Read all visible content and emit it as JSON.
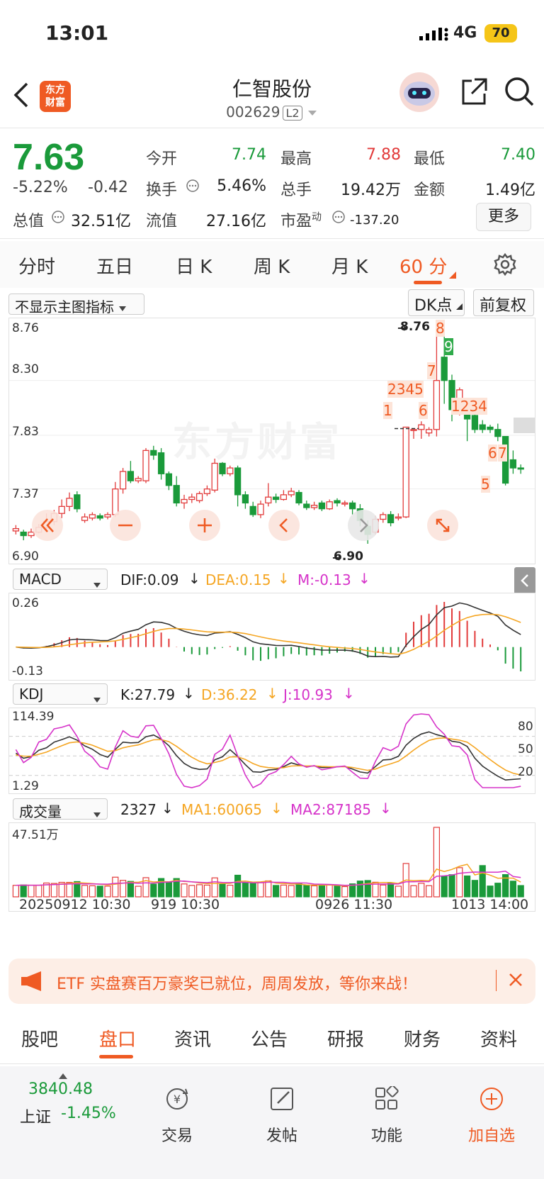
{
  "status": {
    "time": "13:01",
    "network": "4G",
    "battery": "70"
  },
  "header": {
    "title": "仁智股份",
    "code": "002629",
    "level": "L2",
    "logo_text": [
      "东方",
      "财富"
    ]
  },
  "quote": {
    "price": "7.63",
    "change_pct": "-5.22%",
    "change_abs": "-0.42",
    "total_value_label": "总值",
    "total_value": "32.51亿",
    "fields": [
      {
        "label": "今开",
        "value": "7.74"
      },
      {
        "label": "最高",
        "value": "7.88"
      },
      {
        "label": "最低",
        "value": "7.40"
      },
      {
        "label": "换手",
        "value": "5.46%"
      },
      {
        "label": "总手",
        "value": "19.42万"
      },
      {
        "label": "金额",
        "value": "1.49亿"
      },
      {
        "label": "流值",
        "value": "27.16亿"
      },
      {
        "label": "市盈",
        "sup": "动",
        "value": "-137.20"
      }
    ],
    "more": "更多"
  },
  "tabs": [
    "分时",
    "五日",
    "日 K",
    "周 K",
    "月 K",
    "60 分"
  ],
  "active_tab": "60 分",
  "main_chart": {
    "indicator_select": "不显示主图指标",
    "dk_button": "DK点",
    "adjust_button": "前复权",
    "y_labels": [
      "8.76",
      "8.30",
      "7.83",
      "7.37",
      "6.90"
    ],
    "max_label": "8.76",
    "min_label": "6.90",
    "watermark": "东方财富",
    "markers": [
      "1",
      "2345",
      "6",
      "7",
      "8",
      "9",
      "1234",
      "5",
      "6",
      "7"
    ]
  },
  "macd": {
    "select": "MACD",
    "dif": "DIF:0.09",
    "dea": "DEA:0.15",
    "m": "M:-0.13",
    "top": "0.26",
    "bottom": "-0.13"
  },
  "kdj": {
    "select": "KDJ",
    "k": "K:27.79",
    "d": "D:36.22",
    "j": "J:10.93",
    "top": "114.39",
    "bottom": "1.29",
    "levels": [
      "80",
      "50",
      "20"
    ]
  },
  "volume": {
    "select": "成交量",
    "value": "2327",
    "ma1": "MA1:60065",
    "ma2": "MA2:87185",
    "top": "47.51万"
  },
  "x_labels": [
    "20250912 10:30",
    "919 10:30",
    "0926 11:30",
    "1013 14:00"
  ],
  "banner": {
    "text": "ETF 实盘赛百万豪奖已就位，周周发放，等你来战！"
  },
  "bottom_tabs": [
    "股吧",
    "盘口",
    "资讯",
    "公告",
    "研报",
    "财务",
    "资料"
  ],
  "active_bottom_tab": "盘口",
  "bottom_bar": {
    "index_value": "3840.48",
    "index_name": "上证",
    "index_change": "-1.45%",
    "buttons": [
      "交易",
      "发帖",
      "功能",
      "加自选"
    ]
  },
  "colors": {
    "up": "#e23b3b",
    "down": "#1a9a3a",
    "accent": "#ef5a23",
    "dea": "#f5a623",
    "j": "#d633c9"
  },
  "candles": [
    [
      7.01,
      7.03,
      6.98,
      7.06
    ],
    [
      7.0,
      6.97,
      6.93,
      7.02
    ],
    [
      6.97,
      7.0,
      6.95,
      7.03
    ],
    [
      7.0,
      7.04,
      6.99,
      7.07
    ],
    [
      7.04,
      7.09,
      7.02,
      7.16
    ],
    [
      7.09,
      7.16,
      7.06,
      7.19
    ],
    [
      7.16,
      7.22,
      7.12,
      7.28
    ],
    [
      7.22,
      7.29,
      7.18,
      7.34
    ],
    [
      7.32,
      7.2,
      7.17,
      7.35
    ],
    [
      7.1,
      7.13,
      7.08,
      7.16
    ],
    [
      7.12,
      7.15,
      7.1,
      7.17
    ],
    [
      7.14,
      7.12,
      7.1,
      7.16
    ],
    [
      7.13,
      7.15,
      7.11,
      7.17
    ],
    [
      7.15,
      7.37,
      7.13,
      7.43
    ],
    [
      7.37,
      7.52,
      7.33,
      7.55
    ],
    [
      7.52,
      7.44,
      7.42,
      7.61
    ],
    [
      7.44,
      7.46,
      7.42,
      7.48
    ],
    [
      7.44,
      7.7,
      7.42,
      7.72
    ],
    [
      7.7,
      7.66,
      7.62,
      7.74
    ],
    [
      7.68,
      7.5,
      7.45,
      7.72
    ],
    [
      7.5,
      7.4,
      7.36,
      7.52
    ],
    [
      7.4,
      7.25,
      7.22,
      7.48
    ],
    [
      7.25,
      7.28,
      7.2,
      7.32
    ],
    [
      7.28,
      7.3,
      7.25,
      7.33
    ],
    [
      7.27,
      7.33,
      7.25,
      7.35
    ],
    [
      7.33,
      7.37,
      7.31,
      7.4
    ],
    [
      7.36,
      7.59,
      7.34,
      7.63
    ],
    [
      7.59,
      7.5,
      7.48,
      7.6
    ],
    [
      7.5,
      7.55,
      7.48,
      7.57
    ],
    [
      7.55,
      7.32,
      7.22,
      7.57
    ],
    [
      7.32,
      7.25,
      7.2,
      7.35
    ],
    [
      7.22,
      7.15,
      7.13,
      7.26
    ],
    [
      7.15,
      7.24,
      7.12,
      7.27
    ],
    [
      7.25,
      7.3,
      7.22,
      7.42
    ],
    [
      7.3,
      7.28,
      7.25,
      7.33
    ],
    [
      7.28,
      7.32,
      7.27,
      7.36
    ],
    [
      7.32,
      7.35,
      7.3,
      7.38
    ],
    [
      7.34,
      7.25,
      7.23,
      7.36
    ],
    [
      7.24,
      7.21,
      7.19,
      7.27
    ],
    [
      7.21,
      7.23,
      7.19,
      7.26
    ],
    [
      7.25,
      7.2,
      7.18,
      7.27
    ],
    [
      7.2,
      7.26,
      7.19,
      7.28
    ],
    [
      7.27,
      7.25,
      7.22,
      7.29
    ],
    [
      7.24,
      7.25,
      7.22,
      7.27
    ],
    [
      7.25,
      7.2,
      7.15,
      7.27
    ],
    [
      7.2,
      7.1,
      7.05,
      7.24
    ],
    [
      7.05,
      6.98,
      6.9,
      7.1
    ],
    [
      7.0,
      7.11,
      6.98,
      7.14
    ],
    [
      7.11,
      7.15,
      7.08,
      7.17
    ],
    [
      7.15,
      7.08,
      7.05,
      7.18
    ],
    [
      7.12,
      7.13,
      7.1,
      7.16
    ],
    [
      7.13,
      7.9,
      7.12,
      7.9
    ],
    [
      7.88,
      7.88,
      7.8,
      7.88
    ],
    [
      7.88,
      7.92,
      7.8,
      7.95
    ],
    [
      7.85,
      7.88,
      7.82,
      7.9
    ],
    [
      7.88,
      8.3,
      7.82,
      8.76
    ],
    [
      8.5,
      8.3,
      8.1,
      8.76
    ],
    [
      8.3,
      8.05,
      7.95,
      8.35
    ],
    [
      8.05,
      8.22,
      8.0,
      8.24
    ],
    [
      8.12,
      7.97,
      7.78,
      8.14
    ],
    [
      8.0,
      7.88,
      7.85,
      8.08
    ],
    [
      7.92,
      7.88,
      7.85,
      7.96
    ],
    [
      7.9,
      7.88,
      7.85,
      7.92
    ],
    [
      7.88,
      7.82,
      7.78,
      7.93
    ],
    [
      7.82,
      7.42,
      7.4,
      7.82
    ],
    [
      7.62,
      7.55,
      7.5,
      7.7
    ],
    [
      7.55,
      7.54,
      7.5,
      7.58
    ]
  ]
}
